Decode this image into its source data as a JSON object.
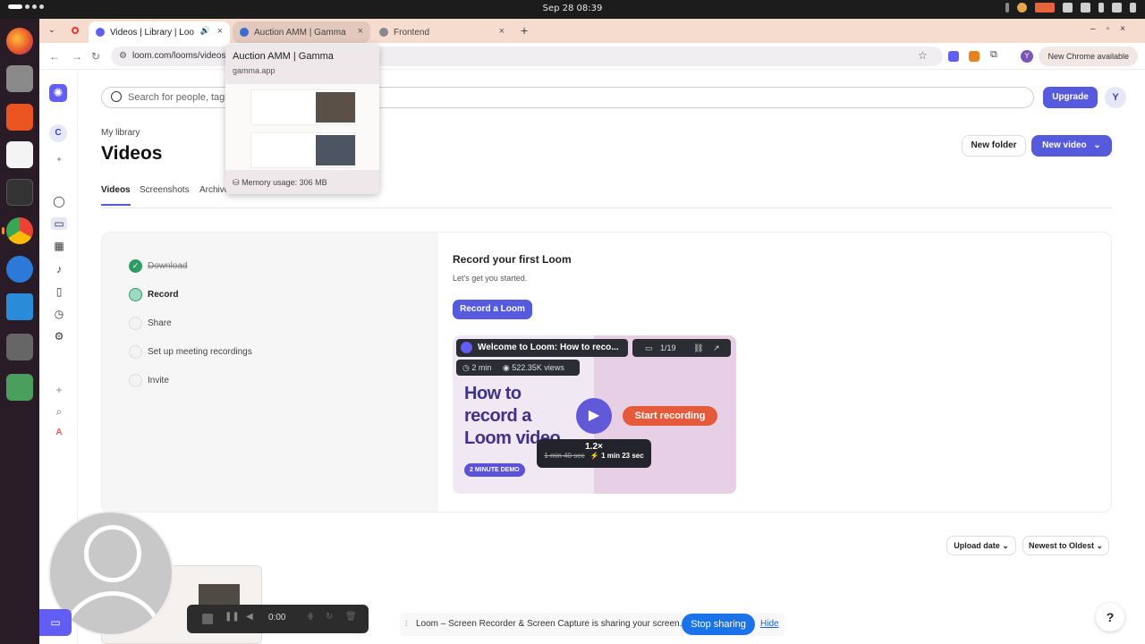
{
  "system": {
    "clock": "Sep 28  08:39"
  },
  "browser": {
    "tabs": [
      {
        "title": "Videos | Library | Loo"
      },
      {
        "title": "Auction AMM | Gamma"
      },
      {
        "title": "Frontend"
      }
    ],
    "url": "loom.com/looms/videos",
    "new_chrome_label": "New Chrome available",
    "profile_initial": "Y"
  },
  "tooltip": {
    "title": "Auction AMM | Gamma",
    "domain": "gamma.app",
    "memory": "Memory usage: 306 MB"
  },
  "loom": {
    "sidebar_initial": "C",
    "search_placeholder": "Search for people, tags, f",
    "upgrade_label": "Upgrade",
    "user_initial": "Y",
    "breadcrumb": "My library",
    "page_title": "Videos",
    "new_folder_label": "New folder",
    "new_video_label": "New video",
    "tabs": [
      "Videos",
      "Screenshots",
      "Archive"
    ],
    "steps": [
      {
        "label": "Download",
        "state": "done"
      },
      {
        "label": "Record",
        "state": "current"
      },
      {
        "label": "Share",
        "state": "todo"
      },
      {
        "label": "Set up meeting recordings",
        "state": "todo"
      },
      {
        "label": "Invite",
        "state": "todo"
      }
    ],
    "record_title": "Record your first Loom",
    "record_subtitle": "Let's get you started.",
    "record_button": "Record a Loom",
    "video": {
      "title": "Welcome to Loom: How to reco...",
      "counter": "1/19",
      "duration": "2 min",
      "views": "522.35K views",
      "headline": "How to record a Loom video",
      "badge": "2 MINUTE DEMO",
      "cta": "Start recording",
      "speed": "1.2×",
      "old_time": "1 min 40 sec",
      "new_time": "⚡ 1 min 23 sec"
    },
    "sort_upload": "Upload date",
    "sort_order": "Newest to Oldest"
  },
  "recorder": {
    "time": "0:00"
  },
  "share_bar": {
    "message": "Loom – Screen Recorder & Screen Capture is sharing your screen.",
    "stop": "Stop sharing",
    "hide": "Hide"
  },
  "help_label": "?"
}
